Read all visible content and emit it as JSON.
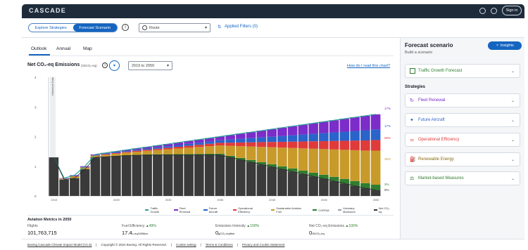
{
  "app": {
    "title": "CASCADE",
    "sign_in": "Sign in"
  },
  "modebar": {
    "explore": "Explore Strategies",
    "forecast": "Forecast Scenario",
    "route_placeholder": "Route",
    "applied_filters": "Applied Filters (0)"
  },
  "tabs": [
    "Outlook",
    "Annual",
    "Map"
  ],
  "chart_header": {
    "title": "Net CO₂-eq Emissions",
    "unit": "(GtCO₂-eq)",
    "range": "2019 to 2050",
    "help_link": "How do I read this chart?"
  },
  "chart_data": {
    "type": "area",
    "x_ticks": [
      "2019",
      "2025",
      "2030",
      "2035",
      "2040",
      "2045",
      "2050"
    ],
    "y_ticks": [
      "0",
      "1",
      "2",
      "3",
      "4"
    ],
    "ylabel": "Historical Data",
    "ylim": [
      0,
      4
    ],
    "years": [
      2019,
      2020,
      2021,
      2022,
      2023,
      2024,
      2025,
      2026,
      2027,
      2028,
      2029,
      2030,
      2031,
      2032,
      2033,
      2034,
      2035,
      2036,
      2037,
      2038,
      2039,
      2040,
      2041,
      2042,
      2043,
      2044,
      2045,
      2046,
      2047,
      2048,
      2049,
      2050
    ],
    "traffic_growth": [
      1.3,
      0.6,
      0.7,
      1.0,
      1.4,
      1.45,
      1.5,
      1.55,
      1.6,
      1.65,
      1.7,
      1.75,
      1.8,
      1.85,
      1.9,
      1.95,
      2.0,
      2.05,
      2.1,
      2.15,
      2.2,
      2.25,
      2.3,
      2.35,
      2.4,
      2.45,
      2.5,
      2.55,
      2.6,
      2.65,
      2.7,
      2.75
    ],
    "net_co2": [
      1.3,
      0.55,
      0.6,
      0.9,
      1.3,
      1.32,
      1.34,
      1.36,
      1.37,
      1.38,
      1.38,
      1.38,
      1.38,
      1.38,
      1.38,
      1.38,
      1.38,
      1.3,
      1.22,
      1.14,
      1.06,
      0.98,
      0.9,
      0.82,
      0.74,
      0.66,
      0.58,
      0.5,
      0.42,
      0.34,
      0.26,
      0.2
    ],
    "right_labels": [
      {
        "text": "17%",
        "color": "#7b2cc9"
      },
      {
        "text": "17%",
        "color": "#2a63c9"
      },
      {
        "text": "65%",
        "color": "#e03a3a"
      },
      {
        "text": "35%",
        "color": "#c89a2a"
      },
      {
        "text": "3%",
        "color": "#2f7d2f"
      },
      {
        "text": "0%",
        "color": "#333333"
      }
    ],
    "legend": [
      {
        "name": "Traffic Growth",
        "color": "#2aa198"
      },
      {
        "name": "Fleet Renewal",
        "color": "#7b2cc9"
      },
      {
        "name": "Future Aircraft",
        "color": "#2a63c9"
      },
      {
        "name": "Operational Efficiency",
        "color": "#e03a3a"
      },
      {
        "name": "Sustainable Aviation Fuel",
        "color": "#c89a2a"
      },
      {
        "name": "CORSIA",
        "color": "#2f7d2f"
      },
      {
        "name": "Voluntary Measures",
        "color": "#9aa0a6"
      },
      {
        "name": "Net CO₂-eq",
        "color": "#333333"
      }
    ]
  },
  "metrics": {
    "title": "Aviation Metrics in 2050",
    "items": [
      {
        "label": "Flights",
        "value": "101,763,715",
        "unit": "",
        "delta": ""
      },
      {
        "label": "Fuel Efficiency",
        "value": "17.4",
        "unit": "L-eq/100tkm",
        "delta": "▲49%"
      },
      {
        "label": "Emissions Intensity",
        "value": "0",
        "unit": "gCO₂-eq/tkm",
        "delta": "▲100%"
      },
      {
        "label": "Net CO₂-eq Emissions",
        "value": "0",
        "unit": "GtCO₂-eq",
        "delta": "▲100%"
      }
    ]
  },
  "right": {
    "title": "Forecast scenario",
    "subtitle": "Build a scenario",
    "insights": "Insights",
    "traffic": "Traffic Growth Forecast",
    "strategies_title": "Strategies",
    "strategies": [
      "Fleet Renewal",
      "Future Aircraft",
      "Operational Efficiency",
      "Renewable Energy",
      "Market-based Measures"
    ]
  },
  "footer": [
    "Boeing Cascade Climate Impact Model (V1.6)",
    "|",
    "Copyright © 2024 Boeing. All Rights Reserved.",
    "|",
    "Cookie setting",
    "|",
    "Terms & Conditions",
    "|",
    "Privacy and Cookie Statement"
  ],
  "colors": {
    "accent": "#1565c0",
    "topbar": "#1e2b3a"
  }
}
